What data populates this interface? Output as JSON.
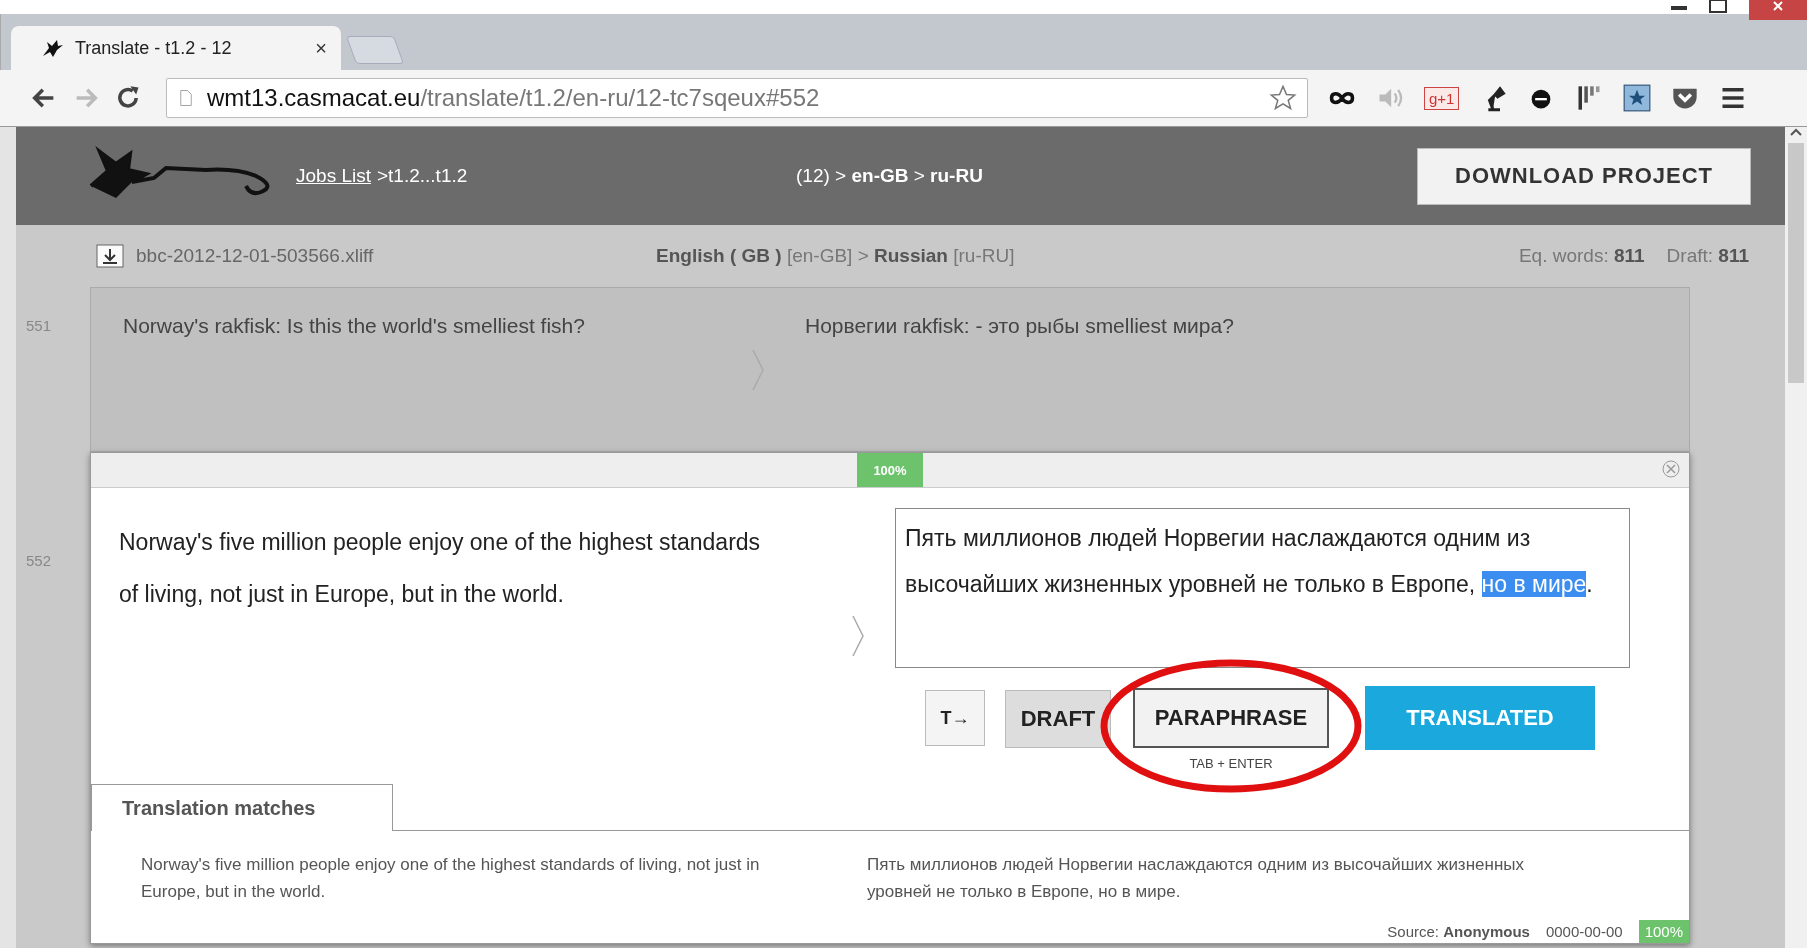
{
  "browser": {
    "tabs": [
      {
        "title": "Translate - t1.2 - 12",
        "close": "×",
        "selected": true
      }
    ],
    "url": {
      "host": "wmt13.casmacat.eu",
      "path": "/translate/t1.2/en-ru/12-tc7sqeux#552"
    },
    "extension_badge": "g+1"
  },
  "header": {
    "breadcrumb_link": "Jobs List",
    "breadcrumb_rest": ">t1.2...t1.2",
    "language_path": "(12) > **en-GB** > **ru-RU**",
    "download_button": "DOWNLOAD PROJECT"
  },
  "file_bar": {
    "file_name": "bbc-2012-12-01-503566.xliff",
    "languages": "**English ( GB )** [en-GB] > **Russian** [ru-RU]",
    "eq_words": "Eq. words: **811**",
    "draft": "Draft: **811**"
  },
  "segments": [
    {
      "kind": "done",
      "number": "551",
      "source": "Norway's rakfisk: Is this the world's smelliest fish?",
      "target": "Норвегии rakfisk: - это рыбы smelliest мира?"
    },
    {
      "kind": "active",
      "number": "552",
      "match_badge": "100%",
      "source": "Norway's five million people enjoy one of the highest standards of living, not just in Europe, but in the world.",
      "target_before": "Пять миллионов людей Норвегии наслаждаются одним из высочайших жизненных уровней не только в Европе, ",
      "target_selected": "но в мире",
      "target_after": ".",
      "actions": [
        {
          "kind": "copy",
          "label": "T→"
        },
        {
          "kind": "draft",
          "label": "DRAFT"
        },
        {
          "kind": "paraphrase",
          "label": "PARAPHRASE",
          "hint": "TAB + ENTER"
        },
        {
          "kind": "translated",
          "label": "TRANSLATED"
        }
      ],
      "matches": {
        "tab": "Translation matches",
        "source": "Norway's five million people enjoy one of the highest standards of living, not just in Europe, but in the world.",
        "target": "Пять миллионов людей Норвегии наслаждаются одним из высочайших жизненных уровней не только в Европе, но в мире.",
        "source_label": "Source:",
        "author": "Anonymous",
        "date": "0000-00-00",
        "score": "100%"
      }
    }
  ]
}
